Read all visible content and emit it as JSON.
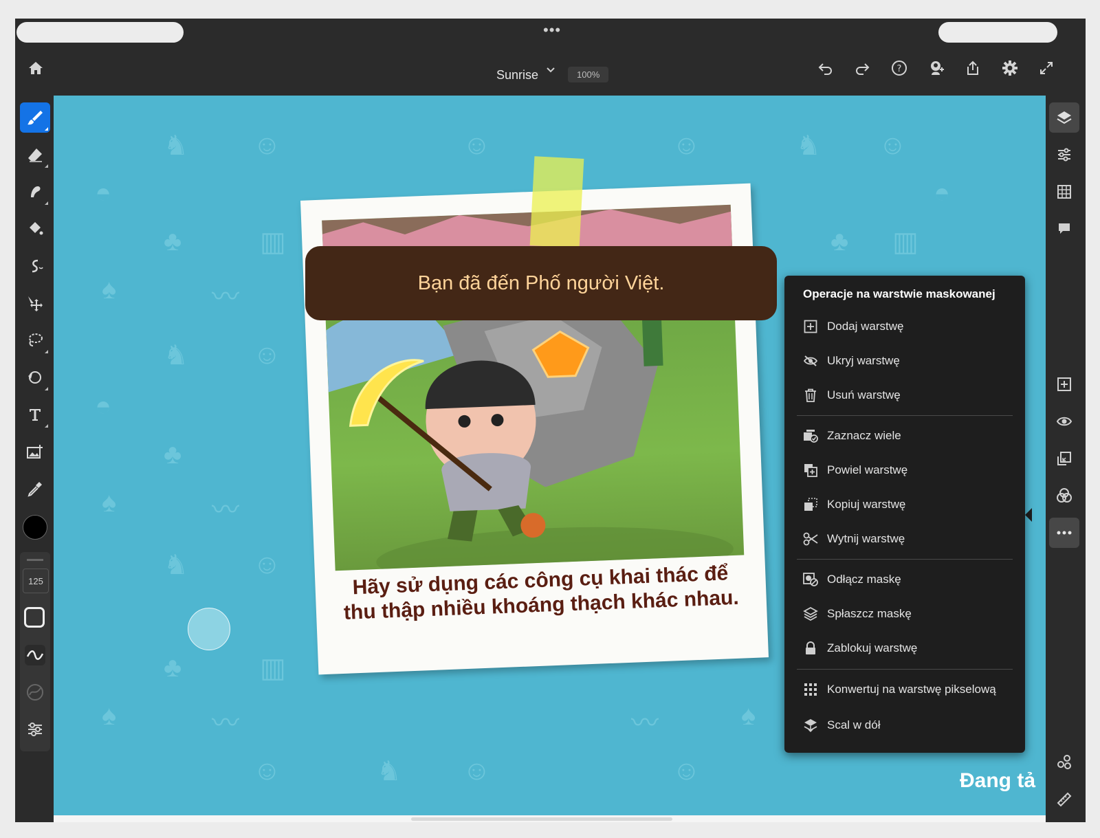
{
  "app": {
    "document_title": "Sunrise",
    "zoom": "100%",
    "brush_size": "125",
    "icons": {
      "top": [
        "home-icon",
        "undo-icon",
        "redo-icon",
        "help-icon",
        "invite-icon",
        "share-icon",
        "settings-icon",
        "fullscreen-icon"
      ],
      "left": [
        "brush-icon",
        "eraser-icon",
        "smudge-icon",
        "fill-icon",
        "liquify-icon",
        "move-icon",
        "lasso-icon",
        "refine-icon",
        "type-icon",
        "place-image-icon",
        "eyedropper-icon"
      ],
      "right": [
        "layers-icon",
        "adjustments-icon",
        "grid-icon",
        "comment-icon",
        "add-layer-icon",
        "visibility-icon",
        "mask-icon",
        "blend-icon",
        "more-icon",
        "properties-icon",
        "ruler-icon"
      ]
    },
    "colors": {
      "accent": "#1473e6",
      "canvas": "#4fb6d0",
      "menu_bg": "#1e1e1e",
      "foreground_color": "#000000"
    }
  },
  "canvas": {
    "banner_text": "Bạn đã đến Phố người Việt.",
    "caption_line1": "Hãy sử dụng các công cụ khai thác để",
    "caption_line2": "thu thập nhiều khoáng thạch khác nhau.",
    "corner_text": "Đang tả"
  },
  "menu": {
    "title": "Operacje na warstwie maskowanej",
    "items": [
      {
        "label": "Dodaj warstwę",
        "icon": "add-layer-icon"
      },
      {
        "label": "Ukryj warstwę",
        "icon": "hide-icon"
      },
      {
        "label": "Usuń warstwę",
        "icon": "trash-icon"
      },
      {
        "label": "Zaznacz wiele",
        "icon": "select-multiple-icon"
      },
      {
        "label": "Powiel warstwę",
        "icon": "duplicate-icon"
      },
      {
        "label": "Kopiuj warstwę",
        "icon": "copy-icon"
      },
      {
        "label": "Wytnij warstwę",
        "icon": "scissors-icon"
      },
      {
        "label": "Odłącz maskę",
        "icon": "detach-mask-icon"
      },
      {
        "label": "Spłaszcz maskę",
        "icon": "flatten-mask-icon"
      },
      {
        "label": "Zablokuj warstwę",
        "icon": "lock-icon"
      },
      {
        "label": "Konwertuj na warstwę pikselową",
        "icon": "pixel-layer-icon"
      },
      {
        "label": "Scal w dół",
        "icon": "merge-down-icon"
      }
    ]
  }
}
